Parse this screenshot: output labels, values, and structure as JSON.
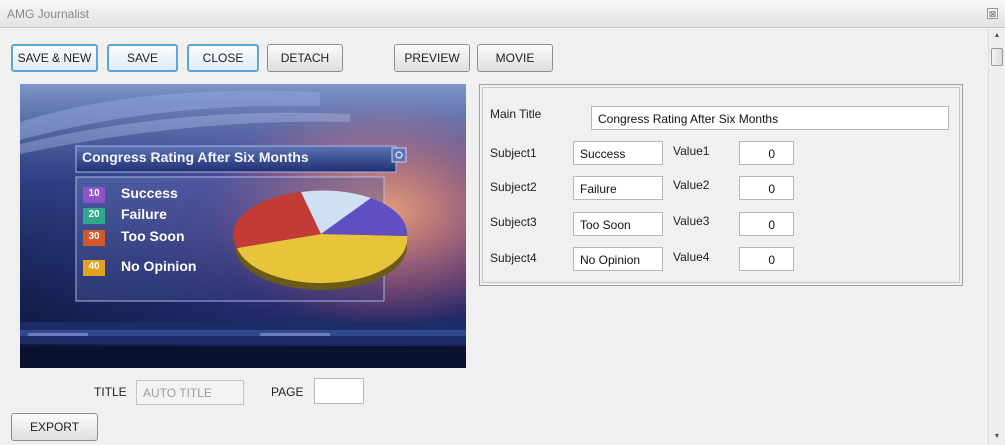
{
  "window": {
    "title": "AMG Journalist",
    "close_glyph": "⊠"
  },
  "toolbar": {
    "save_new": "SAVE & NEW",
    "save": "SAVE",
    "close": "CLOSE",
    "detach": "DETACH",
    "preview": "PREVIEW",
    "movie": "MOVIE"
  },
  "graphic": {
    "title": "Congress Rating After Six Months",
    "items": [
      {
        "num": "10",
        "label": "Success",
        "color": "#8b55c8"
      },
      {
        "num": "20",
        "label": "Failure",
        "color": "#2fa98c"
      },
      {
        "num": "30",
        "label": "Too Soon",
        "color": "#d2562a"
      },
      {
        "num": "40",
        "label": "No Opinion",
        "color": "#e2a21d"
      }
    ]
  },
  "form": {
    "main_title_label": "Main Title",
    "main_title_value": "Congress Rating After Six Months",
    "rows": [
      {
        "subject_label": "Subject1",
        "subject_value": "Success",
        "value_label": "Value1",
        "value": "0"
      },
      {
        "subject_label": "Subject2",
        "subject_value": "Failure",
        "value_label": "Value2",
        "value": "0"
      },
      {
        "subject_label": "Subject3",
        "subject_value": "Too Soon",
        "value_label": "Value3",
        "value": "0"
      },
      {
        "subject_label": "Subject4",
        "subject_value": "No Opinion",
        "value_label": "Value4",
        "value": "0"
      }
    ]
  },
  "footer": {
    "title_label": "TITLE",
    "title_placeholder": "AUTO TITLE",
    "page_label": "PAGE",
    "page_value": "",
    "export": "EXPORT"
  },
  "scrollbar": {
    "up_glyph": "▲",
    "down_glyph": "▼"
  }
}
